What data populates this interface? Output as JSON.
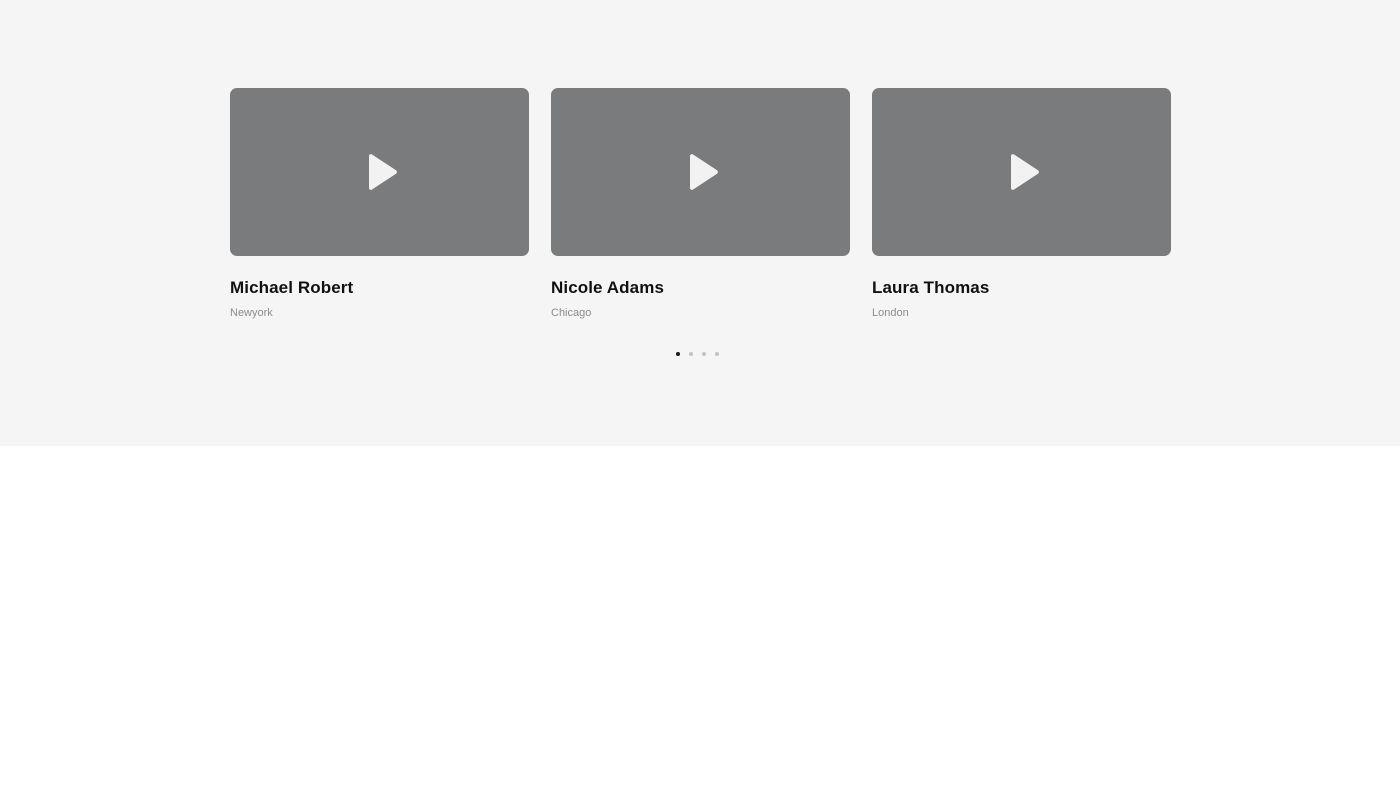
{
  "testimonials": [
    {
      "name": "Michael Robert",
      "city": "Newyork",
      "icon": "play-icon"
    },
    {
      "name": "Nicole Adams",
      "city": "Chicago",
      "icon": "play-icon"
    },
    {
      "name": "Laura Thomas",
      "city": "London",
      "icon": "play-icon"
    }
  ],
  "pagination": {
    "count": 4,
    "active_index": 0
  },
  "colors": {
    "section_background": "#f5f5f5",
    "thumbnail": "#7a7b7c",
    "play_icon": "#f2f2f2",
    "dot_active": "#1a1a1a",
    "dot_inactive": "#c2c2c2"
  }
}
